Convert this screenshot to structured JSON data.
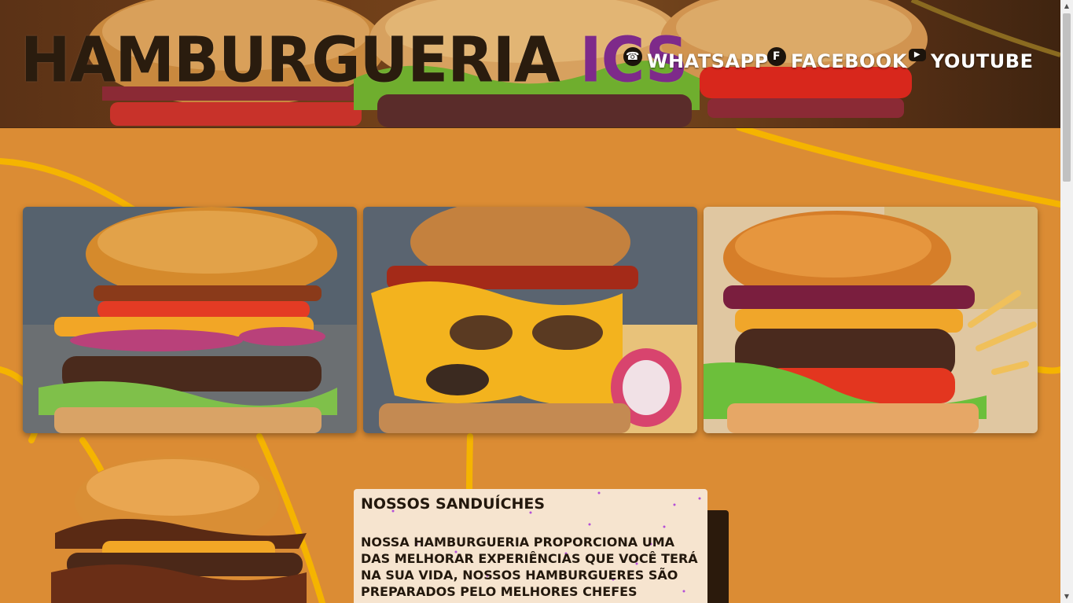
{
  "header": {
    "brand_main": "HAMBURGUERIA",
    "brand_accent": "ICS",
    "nav": [
      {
        "label": "WHATSAPP",
        "icon": "whatsapp-icon"
      },
      {
        "label": "FACEBOOK",
        "icon": "facebook-icon"
      },
      {
        "label": "YOUTUBE",
        "icon": "youtube-icon"
      }
    ]
  },
  "info": {
    "title": "NOSSOS SANDUÍCHES",
    "text": "NOSSA HAMBURGUERIA PROPORCIONA UMA DAS MELHORAR EXPERIÊNCIAS QUE VOCÊ TERÁ NA SUA VIDA, NOSSOS HAMBURGUERES SÃO PREPARADOS PELO MELHORES CHEFES CULINARIOS NO MUNDO INTEIRO, E NOSSOS INGREDIENTE"
  },
  "colors": {
    "page_background": "#db8c34",
    "brand_accent": "#7e2a8a",
    "swirl": "#f5b400",
    "card_background": "#f6e4cf"
  }
}
